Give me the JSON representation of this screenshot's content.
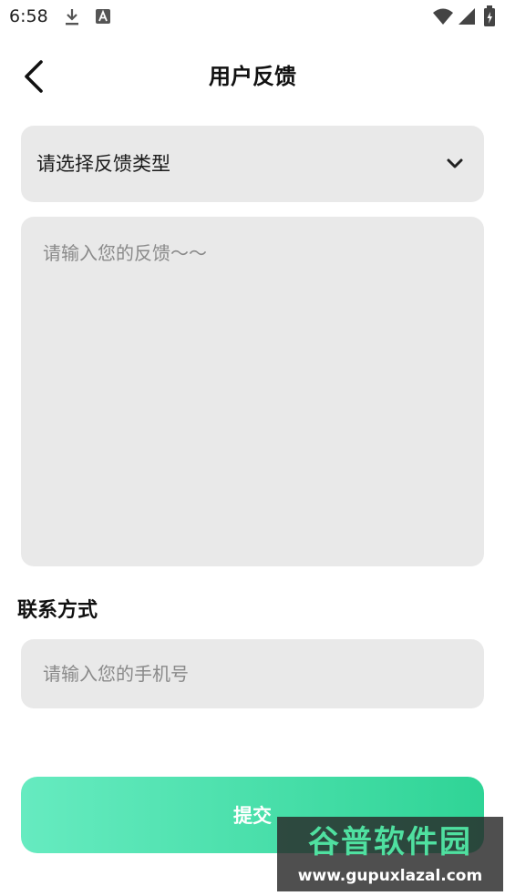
{
  "status_bar": {
    "time": "6:58",
    "icons": [
      "download-icon",
      "text-a-icon",
      "wifi-icon",
      "signal-icon",
      "battery-icon"
    ]
  },
  "header": {
    "title": "用户反馈",
    "back_icon": "chevron-left-icon"
  },
  "form": {
    "type_select": {
      "label": "请选择反馈类型",
      "icon": "chevron-down-icon"
    },
    "feedback": {
      "value": "",
      "placeholder": "请输入您的反馈～～"
    },
    "contact": {
      "heading": "联系方式",
      "phone_value": "",
      "phone_placeholder": "请输入您的手机号"
    },
    "submit_label": "提交"
  },
  "watermark": {
    "title": "谷普软件园",
    "url": "www.gupuxlazal.com"
  },
  "colors": {
    "field_background": "#e9e9e9",
    "button_gradient_start": "#66ebc0",
    "button_gradient_end": "#2fd496",
    "placeholder": "#8a8a8a"
  }
}
